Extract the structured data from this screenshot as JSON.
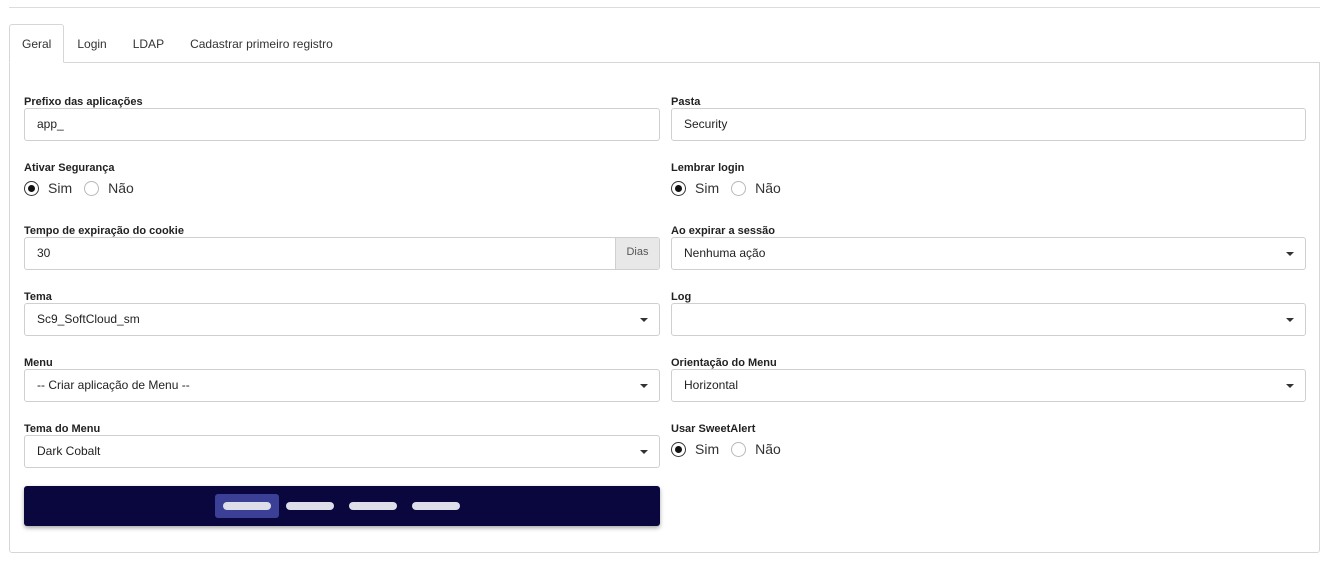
{
  "tabs": [
    {
      "label": "Geral",
      "active": true
    },
    {
      "label": "Login",
      "active": false
    },
    {
      "label": "LDAP",
      "active": false
    },
    {
      "label": "Cadastrar primeiro registro",
      "active": false
    }
  ],
  "left": {
    "prefixo": {
      "label": "Prefixo das aplicações",
      "value": "app_"
    },
    "ativar_seguranca": {
      "label": "Ativar Segurança",
      "options": [
        "Sim",
        "Não"
      ],
      "selected": "Sim"
    },
    "tempo_expiracao": {
      "label": "Tempo de expiração do cookie",
      "value": "30",
      "addon": "Dias"
    },
    "tema": {
      "label": "Tema",
      "value": "Sc9_SoftCloud_sm"
    },
    "menu": {
      "label": "Menu",
      "value": "-- Criar aplicação de Menu --"
    },
    "tema_menu": {
      "label": "Tema do Menu",
      "value": "Dark Cobalt"
    }
  },
  "right": {
    "pasta": {
      "label": "Pasta",
      "value": "Security"
    },
    "lembrar_login": {
      "label": "Lembrar login",
      "options": [
        "Sim",
        "Não"
      ],
      "selected": "Sim"
    },
    "ao_expirar": {
      "label": "Ao expirar a sessão",
      "value": "Nenhuma ação"
    },
    "log": {
      "label": "Log",
      "value": ""
    },
    "orientacao_menu": {
      "label": "Orientação do Menu",
      "value": "Horizontal"
    },
    "usar_sweetalert": {
      "label": "Usar SweetAlert",
      "options": [
        "Sim",
        "Não"
      ],
      "selected": "Sim"
    }
  },
  "menu_preview": {
    "background": "#0a073e",
    "active_item_color": "#3b3f96",
    "item_color": "#dedee8",
    "items": 4,
    "active_index": 0
  }
}
